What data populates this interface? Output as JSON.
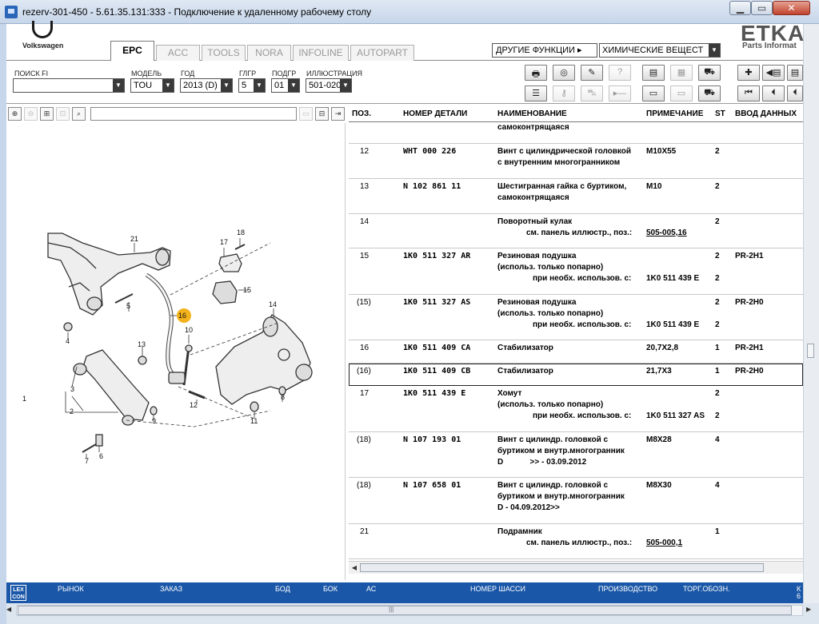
{
  "window": {
    "title": "rezerv-301-450 - 5.61.35.131:333 - Подключение к удаленному рабочему столу",
    "min_glyph": "▁",
    "max_glyph": "▭",
    "close_glyph": "✕"
  },
  "header": {
    "brand": "Volkswagen",
    "tabs": [
      "EPC",
      "ACC",
      "TOOLS",
      "NORA",
      "INFOLINE",
      "AUTOPART"
    ],
    "active_tab": "EPC",
    "functions_label": "ДРУГИЕ ФУНКЦИИ ▸",
    "functions_select": "ХИМИЧЕСКИЕ ВЕЩЕСТ",
    "etka_logo": "ETKA",
    "etka_sub": "Parts Informat"
  },
  "filters": {
    "search": {
      "label": "ПОИСК FI",
      "value": ""
    },
    "model": {
      "label": "МОДЕЛЬ",
      "value": "TOU"
    },
    "year": {
      "label": "ГОД",
      "value": "2013 (D)"
    },
    "main_group": {
      "label": "ГЛГР",
      "value": "5"
    },
    "sub_group": {
      "label": "ПОДГР",
      "value": "01"
    },
    "illustration": {
      "label": "ИЛЛЮСТРАЦИЯ",
      "value": "501-020"
    }
  },
  "table": {
    "headers": {
      "pos": "ПОЗ.",
      "number": "НОМЕР ДЕТАЛИ",
      "name": "НАИМЕНОВАНИЕ",
      "note": "ПРИМЕЧАНИЕ",
      "st": "ST",
      "input": "ВВОД ДАННЫХ"
    },
    "continuation": "самоконтрящаяся",
    "rows": [
      {
        "pos": "12",
        "number": "WHT  000  226",
        "name": "Винт с цилиндрической головкой",
        "name2": "с внутренним многогранником",
        "note": "M10X55",
        "st": "2"
      },
      {
        "pos": "13",
        "number": "N    102  861  11",
        "name": "Шестигранная гайка с буртиком,",
        "name2": "самоконтрящаяся",
        "note": "M10",
        "st": "2"
      },
      {
        "pos": "14",
        "number": "",
        "name": "Поворотный кулак",
        "ref_label": "см. панель иллюстр., поз.:",
        "ref_value": "505-005,16",
        "st": "2"
      },
      {
        "pos": "15",
        "number": "1K0  511  327  AR",
        "name": "Резиновая подушка",
        "name2": "(использ. только попарно)",
        "cond_label": "при необх. использов. с:",
        "cond_value": "1K0 511 439 E",
        "st": "2",
        "st2": "2",
        "input": "PR-2H1"
      },
      {
        "pos": "(15)",
        "number": "1K0  511  327  AS",
        "name": "Резиновая подушка",
        "name2": "(использ. только попарно)",
        "cond_label": "при необх. использов. с:",
        "cond_value": "1K0 511 439 E",
        "st": "2",
        "st2": "2",
        "input": "PR-2H0"
      },
      {
        "pos": "16",
        "number": "1K0  511  409  CA",
        "name": "Стабилизатор",
        "note": "20,7X2,8",
        "st": "1",
        "input": "PR-2H1"
      },
      {
        "pos": "(16)",
        "number": "1K0  511  409  CB",
        "name": "Стабилизатор",
        "note": "21,7X3",
        "st": "1",
        "input": "PR-2H0"
      },
      {
        "pos": "17",
        "number": "1K0  511  439  E",
        "name": "Хомут",
        "name2": "(использ. только попарно)",
        "cond_label": "при необх. использов. с:",
        "cond_value": "1K0 511 327 AS",
        "st": "2",
        "st2": "2"
      },
      {
        "pos": "(18)",
        "number": "N    107  193  01",
        "name": "Винт с цилиндр. головкой с",
        "name2": "буртиком и внутр.многогранник",
        "name3": "D            >> - 03.09.2012",
        "note": "M8X28",
        "st": "4"
      },
      {
        "pos": "(18)",
        "number": "N    107  658  01",
        "name": "Винт с цилиндр. головкой с",
        "name2": "буртиком и внутр.многогранник",
        "name3": "D - 04.09.2012>>",
        "note": "M8X30",
        "st": "4"
      },
      {
        "pos": "21",
        "number": "",
        "name": "Подрамник",
        "ref_label": "см. панель иллюстр., поз.:",
        "ref_value": "505-000,1",
        "st": "1"
      }
    ]
  },
  "illustration": {
    "callouts": [
      "1",
      "2",
      "3",
      "4",
      "5",
      "6",
      "7",
      "8",
      "9",
      "10",
      "11",
      "12",
      "13",
      "14",
      "15",
      "16",
      "17",
      "18",
      "21"
    ],
    "highlighted_callout": "16",
    "highlight_color": "#f2b21b"
  },
  "statusbar": {
    "logo_line1": "LEX",
    "logo_line2": "CON",
    "items": [
      "РЫНОК",
      "ЗАКАЗ",
      "БОД",
      "БОК",
      "АС",
      "НОМЕР ШАССИ",
      "ПРОИЗВОДСТВО",
      "ТОРГ.ОБОЗН."
    ],
    "tail_top": "К",
    "tail_bottom": "6"
  },
  "colors": {
    "statusbar": "#1a57a8",
    "titlebar": "#c7d6ea"
  }
}
